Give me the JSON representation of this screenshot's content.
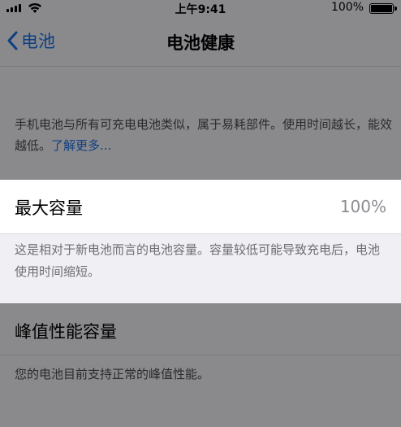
{
  "status_bar": {
    "time": "上午9:41",
    "battery_percent": "100%",
    "battery_level": 1.0,
    "signal_bars": 4
  },
  "nav": {
    "back_label": "电池",
    "title": "电池健康"
  },
  "info": {
    "text": "手机电池与所有可充电电池类似，属于易耗部件。使用时间越长，能效越低。",
    "link": "了解更多..."
  },
  "capacity": {
    "label": "最大容量",
    "value": "100%",
    "description": "这是相对于新电池而言的电池容量。容量较低可能导致充电后，电池使用时间缩短。"
  },
  "peak": {
    "label": "峰值性能容量",
    "description": "您的电池目前支持正常的峰值性能。"
  },
  "colors": {
    "accent": "#0f3f80",
    "dim_background": "#8a8a8d",
    "highlight_cell": "#ffffff"
  }
}
